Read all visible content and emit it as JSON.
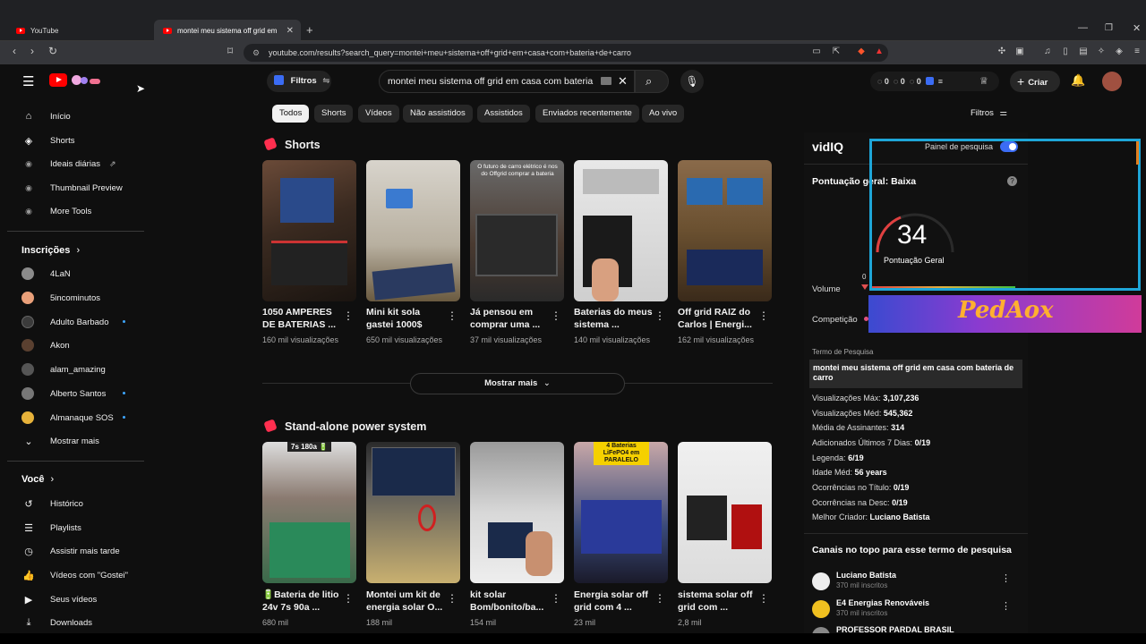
{
  "browser": {
    "tabs": [
      {
        "label": "YouTube",
        "active": false
      },
      {
        "label": "montei meu sistema off grid em",
        "active": true
      }
    ],
    "url": "youtube.com/results?search_query=montei+meu+sistema+off+grid+em+casa+com+bateria+de+carro"
  },
  "header": {
    "filters_label": "Filtros",
    "search_value": "montei meu sistema off grid em casa com bateria",
    "counters": [
      "0",
      "0",
      "0"
    ],
    "create_label": "Criar"
  },
  "sidebar": {
    "main": [
      {
        "label": "Início",
        "icon": "home-icon"
      },
      {
        "label": "Shorts",
        "icon": "shorts-icon"
      },
      {
        "label": "Ideais diárias",
        "icon": "vidiq-icon"
      },
      {
        "label": "Thumbnail Preview",
        "icon": "vidiq-icon"
      },
      {
        "label": "More Tools",
        "icon": "vidiq-icon"
      }
    ],
    "subs_title": "Inscrições",
    "subs": [
      {
        "label": "4LaN",
        "color": "#8b8b8b",
        "dot": false
      },
      {
        "label": "5incominutos",
        "color": "#e9a07a",
        "dot": false
      },
      {
        "label": "Adulto Barbado",
        "color": "#3b3b3b",
        "dot": true
      },
      {
        "label": "Akon",
        "color": "#5a4030",
        "dot": false
      },
      {
        "label": "alam_amazing",
        "color": "#555555",
        "dot": false
      },
      {
        "label": "Alberto Santos",
        "color": "#777777",
        "dot": true
      },
      {
        "label": "Almanaque SOS",
        "color": "#e7b23a",
        "dot": true
      }
    ],
    "show_more": "Mostrar mais",
    "you_title": "Você",
    "you": [
      {
        "label": "Histórico",
        "icon": "history-icon"
      },
      {
        "label": "Playlists",
        "icon": "playlist-icon"
      },
      {
        "label": "Assistir mais tarde",
        "icon": "clock-icon"
      },
      {
        "label": "Vídeos com \"Gostei\"",
        "icon": "like-icon"
      },
      {
        "label": "Seus vídeos",
        "icon": "video-icon"
      },
      {
        "label": "Downloads",
        "icon": "download-icon"
      }
    ]
  },
  "chips": [
    "Todos",
    "Shorts",
    "Vídeos",
    "Não assistidos",
    "Assistidos",
    "Enviados recentemente",
    "Ao vivo"
  ],
  "filters_right": "Filtros",
  "shorts": {
    "title": "Shorts",
    "items": [
      {
        "title": "1050 AMPERES DE BATERIAS ...",
        "views": "160 mil visualizações",
        "overlay": ""
      },
      {
        "title": "Mini kit sola gastei 1000$",
        "views": "650 mil visualizações",
        "overlay": ""
      },
      {
        "title": "Já pensou em comprar uma ...",
        "views": "37 mil visualizações",
        "overlay": "O futuro de carro elétrico é nos do Offgrid comprar a bateria"
      },
      {
        "title": "Baterias do meus sistema ...",
        "views": "140 mil visualizações",
        "overlay": ""
      },
      {
        "title": "Off grid RAIZ do Carlos | Energi...",
        "views": "162 mil visualizações",
        "overlay": ""
      }
    ],
    "show_more": "Mostrar mais"
  },
  "standalone": {
    "title": "Stand-alone power system",
    "items": [
      {
        "title": "🔋Bateria de litio 24v 7s 90a ...",
        "views": "680 mil",
        "overlay": "7s 180a 🔋"
      },
      {
        "title": "Montei um kit de energia solar O...",
        "views": "188 mil",
        "overlay": ""
      },
      {
        "title": "kit solar Bom/bonito/ba...",
        "views": "154 mil",
        "overlay": ""
      },
      {
        "title": "Energia solar off grid com 4 ...",
        "views": "23 mil",
        "overlay": "4 Baterias LiFePO4 em PARALELO"
      },
      {
        "title": "sistema solar off grid com ...",
        "views": "2,8 mil",
        "overlay": ""
      }
    ]
  },
  "vidiq": {
    "logo": "vidIQ",
    "panel_label": "Painel de pesquisa",
    "overall_label": "Pontuação geral: Baixa",
    "score": "34",
    "score_label": "Pontuação Geral",
    "volume_label": "Volume",
    "volume_zero": "0",
    "competition_label": "Competição",
    "watermark": "PedAox",
    "term_label": "Termo de Pesquisa",
    "term": "montei meu sistema off grid em casa com bateria de carro",
    "stats": [
      {
        "k": "Visualizações Máx:",
        "v": "3,107,236"
      },
      {
        "k": "Visualizações Méd:",
        "v": "545,362"
      },
      {
        "k": "Média de Assinantes:",
        "v": "314"
      },
      {
        "k": "Adicionados Últimos 7 Dias:",
        "v": "0/19"
      },
      {
        "k": "Legenda:",
        "v": "6/19"
      },
      {
        "k": "Idade Méd:",
        "v": "56 years"
      },
      {
        "k": "Ocorrências no Título:",
        "v": "0/19"
      },
      {
        "k": "Ocorrências na Desc:",
        "v": "0/19"
      },
      {
        "k": "Melhor Criador:",
        "v": "Luciano Batista"
      }
    ],
    "top_channels_title": "Canais no topo para esse termo de pesquisa",
    "channels": [
      {
        "name": "Luciano Batista",
        "subs": "370 mil inscritos",
        "color": "#eeeeee"
      },
      {
        "name": "E4 Energias Renováveis",
        "subs": "370 mil inscritos",
        "color": "#f0c020"
      },
      {
        "name": "PROFESSOR PARDAL BRASIL",
        "subs": "",
        "color": "#888888"
      }
    ]
  }
}
